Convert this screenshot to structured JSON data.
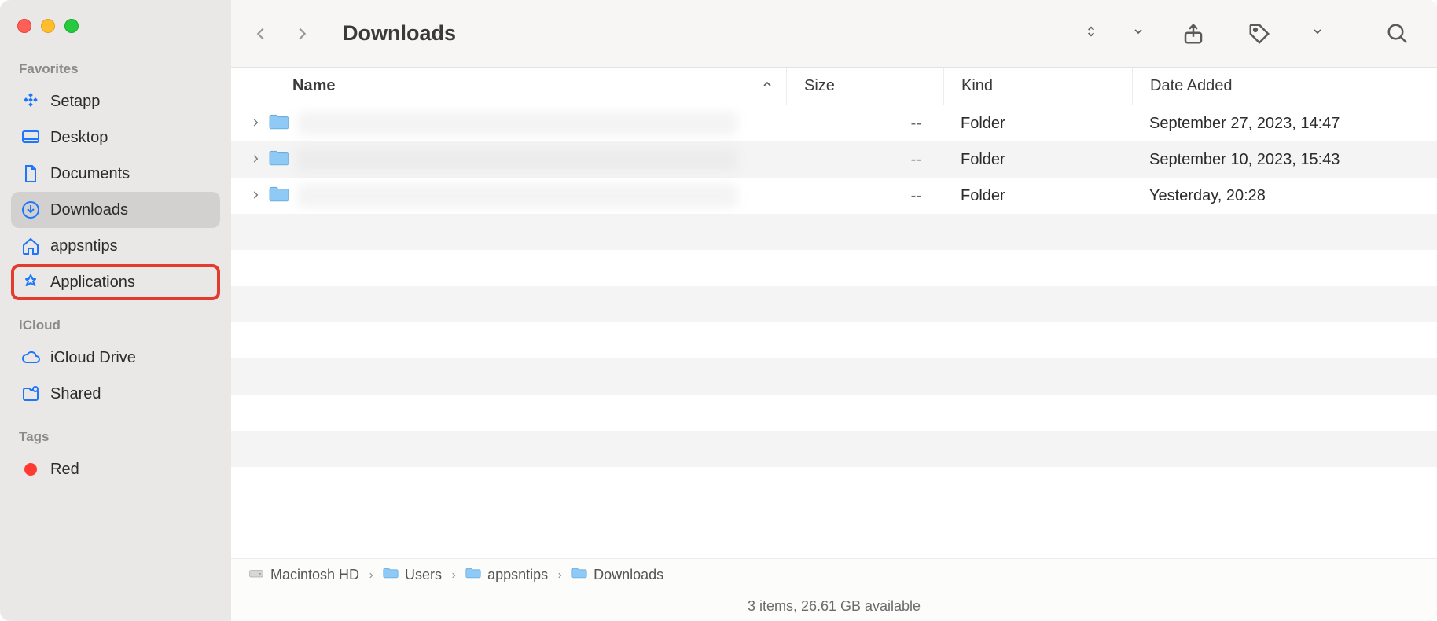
{
  "window": {
    "title": "Downloads"
  },
  "sidebar": {
    "sections": {
      "favorites": {
        "label": "Favorites",
        "items": [
          {
            "label": "Setapp",
            "icon": "setapp-icon"
          },
          {
            "label": "Desktop",
            "icon": "desktop-icon"
          },
          {
            "label": "Documents",
            "icon": "documents-icon"
          },
          {
            "label": "Downloads",
            "icon": "downloads-icon",
            "selected": true
          },
          {
            "label": "appsntips",
            "icon": "home-icon"
          },
          {
            "label": "Applications",
            "icon": "applications-icon",
            "highlighted": true
          }
        ]
      },
      "icloud": {
        "label": "iCloud",
        "items": [
          {
            "label": "iCloud Drive",
            "icon": "cloud-icon"
          },
          {
            "label": "Shared",
            "icon": "shared-folder-icon"
          }
        ]
      },
      "tags": {
        "label": "Tags",
        "items": [
          {
            "label": "Red",
            "color": "#ff3a30"
          }
        ]
      }
    }
  },
  "columns": {
    "name": "Name",
    "size": "Size",
    "kind": "Kind",
    "date_added": "Date Added"
  },
  "rows": [
    {
      "name": "",
      "size": "--",
      "kind": "Folder",
      "date_added": "September 27, 2023, 14:47"
    },
    {
      "name": "",
      "size": "--",
      "kind": "Folder",
      "date_added": "September 10, 2023, 15:43"
    },
    {
      "name": "",
      "size": "--",
      "kind": "Folder",
      "date_added": "Yesterday, 20:28"
    }
  ],
  "pathbar": [
    {
      "label": "Macintosh HD",
      "icon": "disk-icon"
    },
    {
      "label": "Users",
      "icon": "folder-mini-icon"
    },
    {
      "label": "appsntips",
      "icon": "folder-mini-icon"
    },
    {
      "label": "Downloads",
      "icon": "folder-mini-icon"
    }
  ],
  "status": "3 items, 26.61 GB available"
}
